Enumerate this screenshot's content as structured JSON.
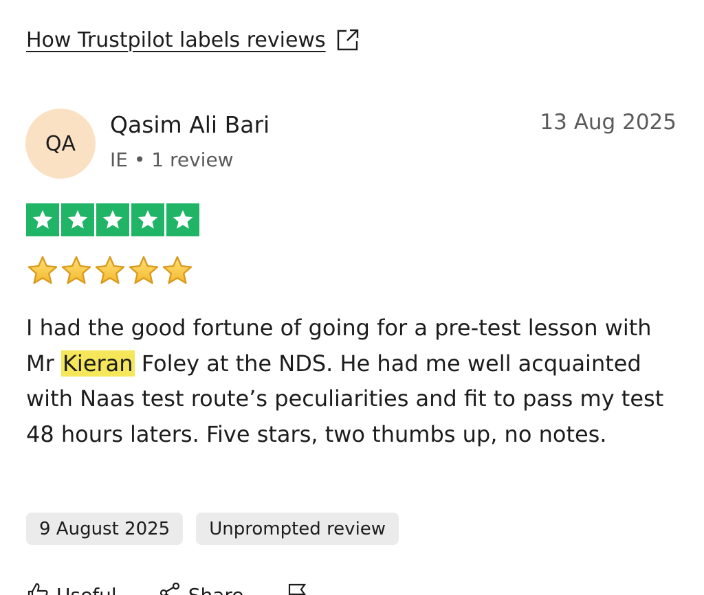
{
  "labels_link": {
    "text": "How Trustpilot labels reviews",
    "icon": "external-link-icon"
  },
  "reviewer": {
    "initials": "QA",
    "name": "Qasim Ali Bari",
    "meta": "IE • 1 review",
    "avatar_color": "#fbe1c4"
  },
  "review": {
    "date": "13 Aug 2025",
    "rating": 5,
    "star_color": "#20b566",
    "text_before": "I had the good fortune of going for a pre-test lesson with Mr ",
    "highlight": "Kieran",
    "text_after": " Foley at the NDS. He had me well acquainted with Naas test route’s peculiarities and fit to pass my test 48 hours laters. Five stars, two thumbs up, no notes.",
    "highlight_color": "#f5e65a"
  },
  "tags": [
    "9 August 2025",
    "Unprompted review"
  ],
  "actions": {
    "useful": "Useful",
    "share": "Share"
  }
}
